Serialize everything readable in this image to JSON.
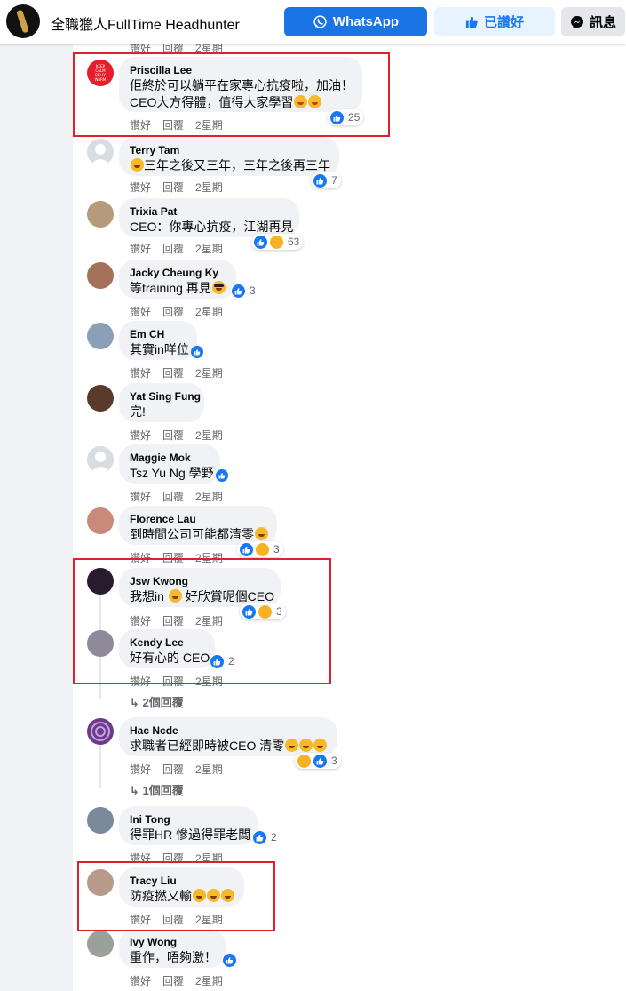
{
  "header": {
    "page_name": "全職獵人FullTime Headhunter",
    "whatsapp_label": "WhatsApp",
    "liked_label": "已讚好",
    "message_label": "訊息"
  },
  "actions": {
    "like": "讚好",
    "reply": "回覆"
  },
  "top_partial": {
    "like": "讚好",
    "reply": "回覆",
    "time": "2星期"
  },
  "comments": [
    {
      "name": "Priscilla Lee",
      "text": "佢終於可以躺平在家專心抗疫啦，加油！",
      "text2": "CEO大方得體，值得大家學習",
      "time": "2星期",
      "count": "25",
      "avatar_text": "KEEP CALM BELLY WARM"
    },
    {
      "name": "Terry Tam",
      "text": "三年之後又三年，三年之後再三年",
      "time": "2星期",
      "count": "7"
    },
    {
      "name": "Trixia Pat",
      "text": "CEO：你專心抗疫，江湖再見",
      "time": "2星期",
      "count": "63"
    },
    {
      "name": "Jacky Cheung Ky",
      "text": "等training 再見",
      "time": "2星期",
      "count": "3"
    },
    {
      "name": "Em CH",
      "text": "其實in咩位",
      "time": "2星期"
    },
    {
      "name": "Yat Sing Fung",
      "text": "完!",
      "time": "2星期"
    },
    {
      "name": "Maggie Mok",
      "text": "Tsz Yu Ng 學野",
      "time": "2星期"
    },
    {
      "name": "Florence Lau",
      "text": "到時間公司可能都清零",
      "time": "2星期",
      "count": "3"
    },
    {
      "name": "Jsw Kwong",
      "text": "我想in",
      "text_after": "好欣賞呢個CEO",
      "time": "2星期",
      "count": "3"
    },
    {
      "name": "Kendy Lee",
      "text": "好有心的 CEO",
      "time": "2星期",
      "count": "2"
    },
    {
      "name": "Hac Ncde",
      "text": "求職者已經即時被CEO 清零",
      "time": "2星期",
      "count": "3"
    },
    {
      "name": "Ini Tong",
      "text": "得罪HR 慘過得罪老闆",
      "time": "2星期",
      "count": "2"
    },
    {
      "name": "Tracy Liu",
      "text": "防疫撚又輸",
      "time": "2星期"
    },
    {
      "name": "Ivy Wong",
      "text": "重作，唔夠激！",
      "time": "2星期"
    }
  ],
  "replies": {
    "thread1": "2個回覆",
    "thread2": "1個回覆"
  },
  "colors": {
    "brand_blue": "#1877f2",
    "highlight_red": "#e0202b",
    "bubble_gray": "#f0f2f5"
  }
}
